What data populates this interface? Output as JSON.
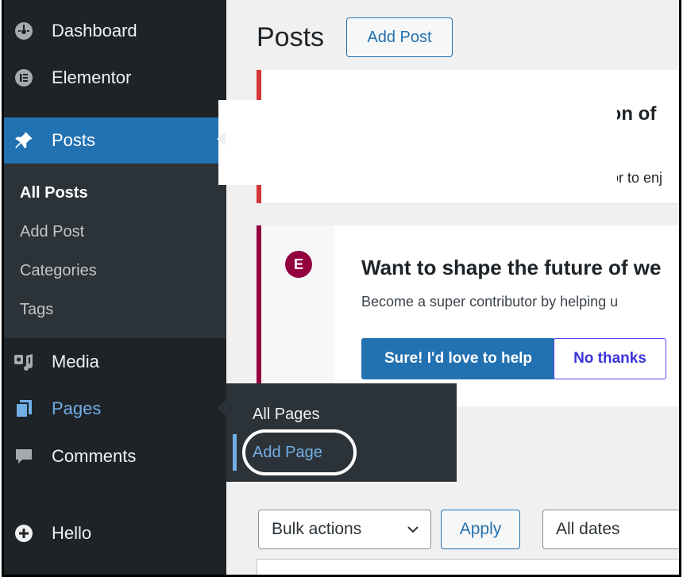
{
  "sidebar": {
    "items": [
      {
        "label": "Dashboard",
        "icon": "dashboard-icon"
      },
      {
        "label": "Elementor",
        "icon": "elementor-icon"
      },
      {
        "label": "Posts",
        "icon": "pin-icon"
      },
      {
        "label": "Media",
        "icon": "media-icon"
      },
      {
        "label": "Pages",
        "icon": "pages-icon"
      },
      {
        "label": "Comments",
        "icon": "comment-icon"
      },
      {
        "label": "Hello",
        "icon": "plus-circle-icon"
      }
    ],
    "posts_submenu": [
      "All Posts",
      "Add Post",
      "Categories",
      "Tags"
    ]
  },
  "flyout": {
    "items": [
      "All Pages",
      "Add Page"
    ]
  },
  "main": {
    "title": "Posts",
    "add_post_label": "Add Post",
    "notice1": {
      "title_fragment": "ion of",
      "text_fragment": "or to enj"
    },
    "notice2": {
      "logo_text": "E",
      "title": "Want to shape the future of we",
      "text": "Become a super contributor by helping u",
      "primary_label": "Sure! I'd love to help",
      "secondary_label": "No thanks"
    },
    "bulk_actions_label": "Bulk actions",
    "apply_label": "Apply",
    "dates_label": "All dates"
  },
  "colors": {
    "sidebar_bg": "#1d2327",
    "active_bg": "#2271b1",
    "link_blue": "#72aee6",
    "elementor": "#93003f"
  }
}
